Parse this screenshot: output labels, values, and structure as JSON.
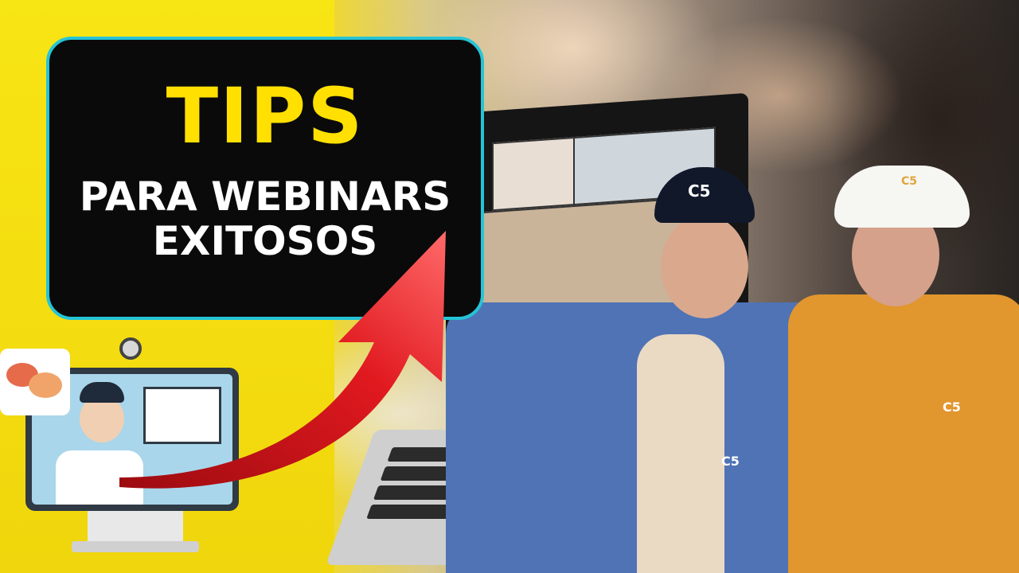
{
  "thumbnail": {
    "title_main": "TIPS",
    "title_line1": "PARA WEBINARS",
    "title_line2": "EXITOSOS",
    "brand_cap_left": "C5",
    "brand_cap_right": "C5",
    "brand_chest_left": "C5",
    "brand_chest_right": "C5"
  },
  "colors": {
    "accent_yellow": "#ffe000",
    "background_yellow": "#f6e016",
    "border_cyan": "#25c4d6",
    "arrow_red": "#d9151b"
  },
  "icons": [
    "speech-bubbles-icon",
    "webcam-icon",
    "red-arrow-icon"
  ]
}
